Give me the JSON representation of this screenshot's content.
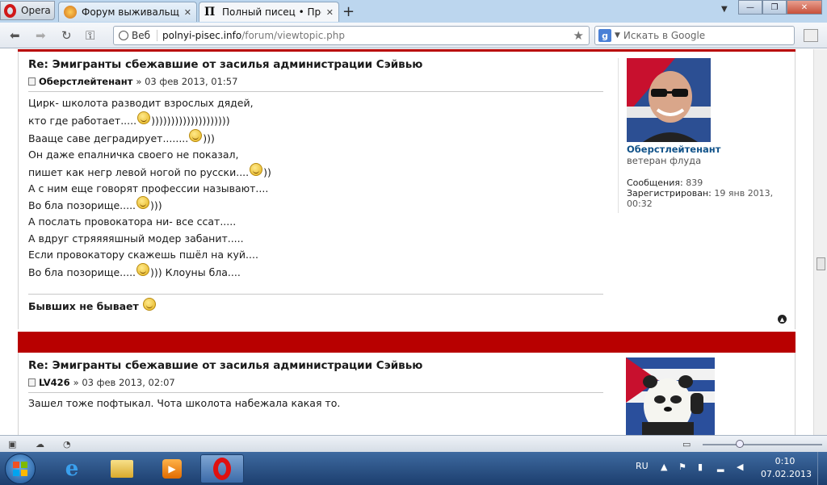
{
  "browser": {
    "menu_label": "Opera",
    "tabs": [
      {
        "title": "Форум выживальщик..."
      },
      {
        "title": "Полный писец • Прос..."
      }
    ],
    "address": {
      "web_badge": "Веб",
      "host": "polnyi-pisec.info",
      "path": "/forum/viewtopic.php"
    },
    "search": {
      "engine_letter": "g",
      "placeholder": "Искать в Google"
    }
  },
  "posts": [
    {
      "title": "Re: Эмигранты сбежавшие от засилья администрации Сэйвью",
      "author": "Оберстлейтенант",
      "date": "» 03 фев 2013, 01:57",
      "lines": [
        {
          "text": "Цирк- школота разводит взрослых дядей,",
          "smile": false,
          "after": ""
        },
        {
          "text": "кто где работает.....",
          "smile": true,
          "after": "))))))))))))))))))))"
        },
        {
          "text": "Вааще саве деградирует........",
          "smile": true,
          "after": ")))"
        },
        {
          "text": "Он даже епалничка своего не показал,",
          "smile": false,
          "after": ""
        },
        {
          "text": "пишет как негр левой ногой по русски....",
          "smile": true,
          "after": "))"
        },
        {
          "text": "А с ним еще говорят профессии называют....",
          "smile": false,
          "after": ""
        },
        {
          "text": "Во бла позорище.....",
          "smile": true,
          "after": ")))"
        },
        {
          "text": "А послать провокатора ни- все ссат.....",
          "smile": false,
          "after": ""
        },
        {
          "text": "А вдруг стряяяяшный модер забанит.....",
          "smile": false,
          "after": ""
        },
        {
          "text": "Если провокатору скажешь пшёл на куй....",
          "smile": false,
          "after": ""
        },
        {
          "text": "Во бла позорище.....",
          "smile": true,
          "after": "))) Клоуны бла...."
        }
      ],
      "signature": "Бывших не бывает",
      "profile": {
        "username": "Оберстлейтенант",
        "rank": "ветеран флуда",
        "posts_label": "Сообщения:",
        "posts_value": "839",
        "registered_label": "Зарегистрирован:",
        "registered_value": "19 янв 2013, 00:32"
      }
    },
    {
      "title": "Re: Эмигранты сбежавшие от засилья администрации Сэйвью",
      "author": "LV426",
      "date": "» 03 фев 2013, 02:07",
      "lines": [
        {
          "text": "Зашел тоже пофтыкал. Чота школота набежала какая то.",
          "smile": false,
          "after": ""
        }
      ]
    }
  ],
  "taskbar": {
    "language": "RU",
    "time": "0:10",
    "date": "07.02.2013"
  },
  "colors": {
    "post_bar": "#b80000",
    "username": "#105289"
  }
}
